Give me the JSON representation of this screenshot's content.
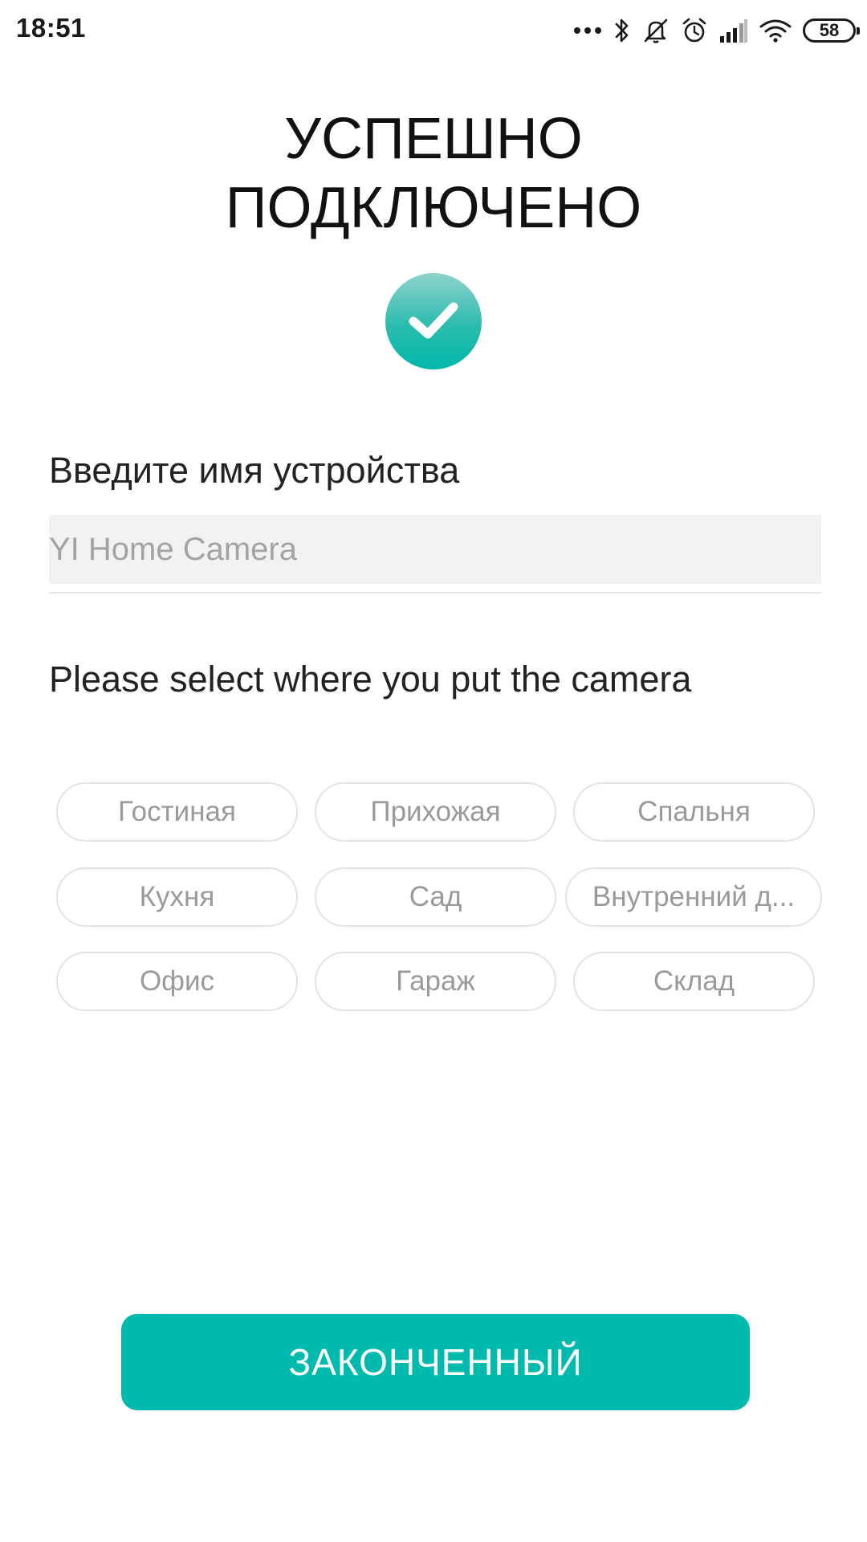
{
  "status_bar": {
    "time": "18:51",
    "battery": "58",
    "icons": [
      "more-dots-icon",
      "bluetooth-icon",
      "silent-icon",
      "alarm-icon",
      "signal-icon",
      "wifi-icon",
      "battery-icon"
    ]
  },
  "title": "УСПЕШНО\nПОДКЛЮЧЕНО",
  "success_icon": "check-circle-icon",
  "device_name": {
    "label": "Введите имя устройства",
    "placeholder": "YI Home Camera",
    "value": ""
  },
  "location": {
    "label": "Please select where you put the camera",
    "options": [
      "Гостиная",
      "Прихожая",
      "Спальня",
      "Кухня",
      "Сад",
      "Внутренний д...",
      "Офис",
      "Гараж",
      "Склад"
    ]
  },
  "finish_button": {
    "label": "ЗАКОНЧЕННЫЙ"
  },
  "colors": {
    "accent": "#00bbad",
    "chip_border": "#e3e3e3",
    "chip_text": "#9a9a9a",
    "input_bg": "#f2f2f2"
  }
}
